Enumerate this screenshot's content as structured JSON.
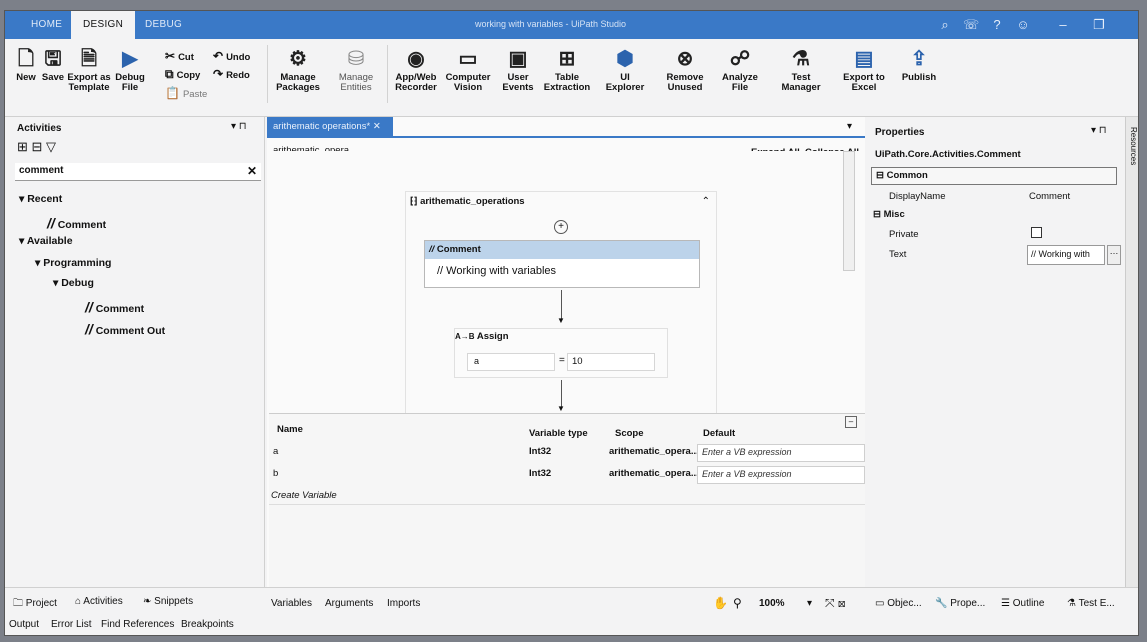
{
  "window": {
    "title": "working with variables - UiPath Studio",
    "tabs": [
      "HOME",
      "DESIGN",
      "DEBUG"
    ]
  },
  "ribbon": {
    "new": "New",
    "save": "Save",
    "export_template": "Export as Template",
    "debug_file": "Debug File",
    "cut": "Cut",
    "copy": "Copy",
    "paste": "Paste",
    "undo": "Undo",
    "redo": "Redo",
    "manage_packages": "Manage Packages",
    "manage_entities": "Manage Entities",
    "app_web_recorder": "App/Web Recorder",
    "computer_vision": "Computer Vision",
    "user_events": "User Events",
    "table_extraction": "Table Extraction",
    "ui_explorer": "UI Explorer",
    "remove_unused": "Remove Unused",
    "analyze_file": "Analyze File",
    "test_manager": "Test Manager",
    "export_excel": "Export to Excel",
    "publish": "Publish"
  },
  "activities": {
    "title": "Activities",
    "search": "comment",
    "recent": "Recent",
    "recent_item": "Comment",
    "available": "Available",
    "programming": "Programming",
    "debug": "Debug",
    "item1": "Comment",
    "item2": "Comment Out"
  },
  "designer": {
    "tab": "arithematic operations*",
    "breadcrumb": "arithematic_opera...",
    "expand_all": "Expand All",
    "collapse_all": "Collapse All",
    "sequence": "arithematic_operations",
    "comment_title": "Comment",
    "comment_text": "// Working with variables",
    "assign_title": "Assign",
    "assign_to": "a",
    "assign_op": "=",
    "assign_value": "10"
  },
  "variables": {
    "headers": {
      "name": "Name",
      "type": "Variable type",
      "scope": "Scope",
      "default": "Default"
    },
    "rows": [
      {
        "name": "a",
        "type": "Int32",
        "scope": "arithematic_opera...",
        "default": "Enter a VB expression"
      },
      {
        "name": "b",
        "type": "Int32",
        "scope": "arithematic_opera...",
        "default": "Enter a VB expression"
      }
    ],
    "create": "Create Variable"
  },
  "properties": {
    "title": "Properties",
    "type": "UiPath.Core.Activities.Comment",
    "common": "Common",
    "displayname_label": "DisplayName",
    "displayname_value": "Comment",
    "misc": "Misc",
    "private_label": "Private",
    "text_label": "Text",
    "text_value": "// Working with",
    "resources": "Resources"
  },
  "bottom": {
    "project": "Project",
    "activities": "Activities",
    "snippets": "Snippets",
    "output": "Output",
    "error_list": "Error List",
    "find_references": "Find References",
    "breakpoints": "Breakpoints",
    "variables_tab": "Variables",
    "arguments_tab": "Arguments",
    "imports_tab": "Imports",
    "zoom": "100%",
    "object": "Objec...",
    "properties": "Prope...",
    "outline": "Outline",
    "test": "Test E..."
  },
  "colors": {
    "titlebar": "#3a79c7",
    "comment_header": "#bcd3ea",
    "accent": "#2c63ad"
  }
}
